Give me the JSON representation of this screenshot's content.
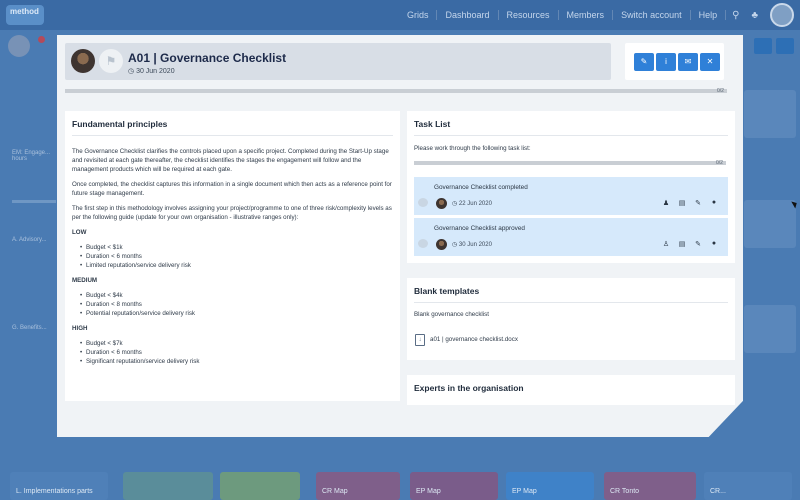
{
  "nav": {
    "logo": "method",
    "items": [
      "Grids",
      "Dashboard",
      "Resources",
      "Members",
      "Switch account",
      "Help"
    ],
    "icons": [
      "search-icon",
      "bell-icon"
    ]
  },
  "background": {
    "left_labels": [
      "EM: Engage... hours",
      "A. Advisory...",
      "G. Benefits..."
    ],
    "bottom_labels": [
      "L. Implementations parts",
      "CR Map",
      "EP Map",
      "EP Map",
      "CR Map",
      "CR Tonto",
      "CR..."
    ]
  },
  "header": {
    "title": "A01 | Governance Checklist",
    "date": "30 Jun 2020",
    "actions": [
      {
        "icon": "pencil-icon",
        "glyph": "✎"
      },
      {
        "icon": "info-icon",
        "glyph": "i"
      },
      {
        "icon": "comment-icon",
        "glyph": "✉"
      },
      {
        "icon": "close-icon",
        "glyph": "✕"
      }
    ]
  },
  "progress": {
    "value": 0,
    "label": "0/2"
  },
  "fundamental": {
    "title": "Fundamental principles",
    "paragraphs": [
      "The Governance Checklist clarifies the controls placed upon a specific project. Completed during the Start-Up stage and revisited at each gate thereafter, the checklist identifies the stages the engagement will follow and the management products which will be required at each gate.",
      "Once completed, the checklist captures this information in a single document which then acts as a reference point for future stage management.",
      "The first step in this methodology involves assigning your project/programme to one of three risk/complexity levels as per the following guide (update for your own organisation - illustrative ranges only):"
    ],
    "levels": [
      {
        "name": "LOW",
        "items": [
          "Budget < $1k",
          "Duration < 6 months",
          "Limited reputation/service delivery risk"
        ]
      },
      {
        "name": "MEDIUM",
        "items": [
          "Budget < $4k",
          "Duration < 8 months",
          "Potential reputation/service delivery risk"
        ]
      },
      {
        "name": "HIGH",
        "items": [
          "Budget < $7k",
          "Duration < 6 months",
          "Significant reputation/service delivery risk"
        ]
      }
    ]
  },
  "tasks": {
    "title": "Task List",
    "intro": "Please work through the following task list:",
    "progress": {
      "value": 0,
      "label": "0/2"
    },
    "items": [
      {
        "name": "Governance Checklist completed",
        "date": "22 Jun 2020"
      },
      {
        "name": "Governance Checklist approved",
        "date": "30 Jun 2020"
      }
    ]
  },
  "templates": {
    "title": "Blank templates",
    "name": "Blank governance checklist",
    "file": "a01 | governance checklist.docx"
  },
  "experts": {
    "title": "Experts in the organisation"
  },
  "colors": {
    "primary": "#2f80d8",
    "task_bg": "#d6e9fb",
    "nav_bg": "#3a6aa4"
  }
}
